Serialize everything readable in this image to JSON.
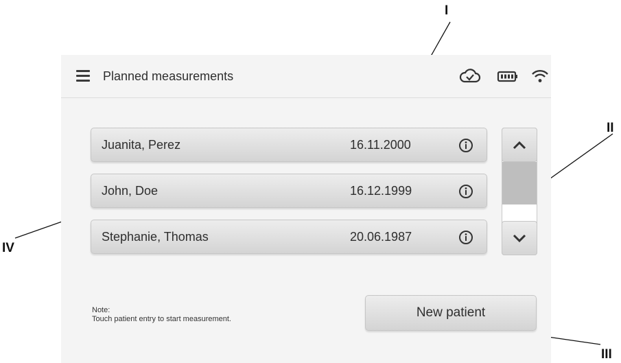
{
  "header": {
    "title": "Planned measurements",
    "menu_icon": "hamburger-menu-icon",
    "status_icons": [
      "cloud-check-icon",
      "battery-icon",
      "wifi-icon"
    ]
  },
  "patients": [
    {
      "name": "Juanita, Perez",
      "date": "16.11.2000",
      "icon": "info-icon"
    },
    {
      "name": "John, Doe",
      "date": "16.12.1999",
      "icon": "info-icon"
    },
    {
      "name": "Stephanie, Thomas",
      "date": "20.06.1987",
      "icon": "info-icon"
    }
  ],
  "scrollbar": {
    "up_icon": "chevron-up-icon",
    "down_icon": "chevron-down-icon"
  },
  "note": {
    "heading": "Note:",
    "text": "Touch patient entry to start measurement."
  },
  "new_patient_label": "New patient",
  "callouts": {
    "I": "I",
    "II": "II",
    "III": "III",
    "IV": "IV"
  }
}
